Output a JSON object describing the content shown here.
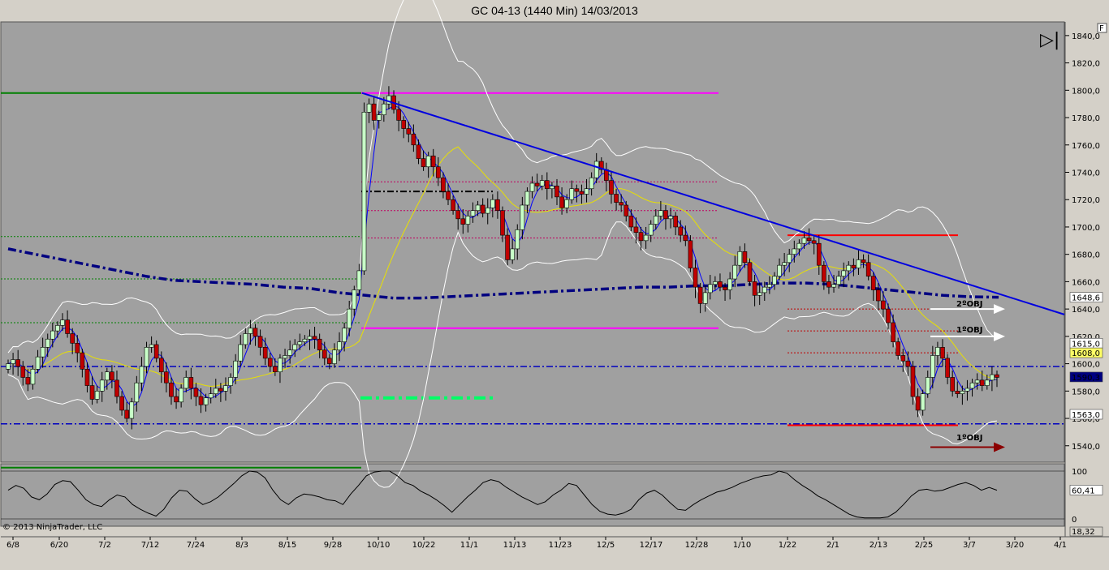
{
  "header": {
    "title": "GC 04-13 (1440 Min)  14/03/2013"
  },
  "copyright": "© 2013 NinjaTrader, LLC",
  "toolbar": {
    "f_button": "F",
    "play_glyph": "▷|"
  },
  "chart_data": {
    "type": "candlestick",
    "instrument": "GC 04-13",
    "period": "1440 Min",
    "date": "14/03/2013",
    "x_tick_labels": [
      "6/8",
      "6/20",
      "7/2",
      "7/12",
      "7/24",
      "8/3",
      "8/15",
      "9/28",
      "10/10",
      "10/22",
      "11/1",
      "11/13",
      "11/23",
      "12/5",
      "12/17",
      "12/28",
      "1/10",
      "1/22",
      "2/1",
      "2/13",
      "2/25",
      "3/7",
      "3/20",
      "4/1"
    ],
    "y_ticks": [
      "1840,0",
      "1820,0",
      "1800,0",
      "1780,0",
      "1760,0",
      "1740,0",
      "1720,0",
      "1700,0",
      "1680,0",
      "1660,0",
      "1640,0",
      "1620,0",
      "1600,0",
      "1580,0",
      "1560,0",
      "1540,0"
    ],
    "ylim": [
      1528,
      1850
    ],
    "close_series": [
      1600,
      1603,
      1598,
      1590,
      1585,
      1596,
      1605,
      1612,
      1618,
      1624,
      1628,
      1632,
      1622,
      1615,
      1608,
      1596,
      1584,
      1574,
      1580,
      1588,
      1594,
      1588,
      1576,
      1566,
      1560,
      1572,
      1586,
      1598,
      1612,
      1614,
      1604,
      1594,
      1586,
      1576,
      1572,
      1582,
      1590,
      1582,
      1576,
      1570,
      1575,
      1578,
      1582,
      1580,
      1584,
      1590,
      1602,
      1614,
      1622,
      1626,
      1620,
      1612,
      1604,
      1598,
      1594,
      1604,
      1606,
      1610,
      1614,
      1616,
      1618,
      1620,
      1618,
      1610,
      1604,
      1600,
      1610,
      1616,
      1626,
      1640,
      1654,
      1668,
      1784,
      1790,
      1778,
      1782,
      1790,
      1796,
      1786,
      1778,
      1772,
      1768,
      1760,
      1750,
      1744,
      1752,
      1744,
      1736,
      1726,
      1720,
      1712,
      1706,
      1702,
      1708,
      1712,
      1716,
      1710,
      1714,
      1720,
      1712,
      1694,
      1676,
      1684,
      1698,
      1716,
      1726,
      1732,
      1730,
      1734,
      1728,
      1730,
      1722,
      1714,
      1720,
      1728,
      1726,
      1724,
      1728,
      1736,
      1748,
      1742,
      1734,
      1724,
      1718,
      1716,
      1708,
      1700,
      1696,
      1690,
      1694,
      1702,
      1708,
      1712,
      1706,
      1708,
      1700,
      1694,
      1690,
      1670,
      1656,
      1644,
      1652,
      1658,
      1660,
      1656,
      1654,
      1662,
      1672,
      1682,
      1674,
      1660,
      1650,
      1652,
      1656,
      1658,
      1664,
      1672,
      1674,
      1680,
      1684,
      1688,
      1692,
      1690,
      1688,
      1672,
      1660,
      1656,
      1658,
      1664,
      1668,
      1672,
      1670,
      1676,
      1674,
      1664,
      1654,
      1646,
      1640,
      1630,
      1616,
      1606,
      1602,
      1598,
      1576,
      1566,
      1578,
      1590,
      1606,
      1612,
      1604,
      1590,
      1580,
      1578,
      1580,
      1582,
      1586,
      1588,
      1584,
      1588,
      1592,
      1590
    ],
    "moving_average_long": [
      1684,
      1680,
      1676,
      1672,
      1668,
      1664,
      1661,
      1660,
      1659,
      1658,
      1656,
      1655,
      1652,
      1650,
      1648,
      1648,
      1649,
      1650,
      1651,
      1652,
      1653,
      1654,
      1655,
      1656,
      1656,
      1657,
      1657,
      1658,
      1659,
      1659,
      1658,
      1656,
      1654,
      1652,
      1650,
      1649,
      1648.6
    ],
    "horizontal_levels": [
      {
        "price": 1798,
        "color": "#008000",
        "style": "solid"
      },
      {
        "price": 1524,
        "color": "#008000",
        "style": "solid"
      },
      {
        "price": 1798,
        "color": "#ff00ff",
        "style": "solid"
      },
      {
        "price": 1626,
        "color": "#ff00ff",
        "style": "solid"
      },
      {
        "price": 1694,
        "color": "#ff0000",
        "style": "solid"
      },
      {
        "price": 1555,
        "color": "#ff0000",
        "style": "solid"
      },
      {
        "price": 1598,
        "color": "#0000c0",
        "style": "dash-dot"
      },
      {
        "price": 1556,
        "color": "#0000c0",
        "style": "dash-dot"
      },
      {
        "price": 1726,
        "color": "#000000",
        "style": "dash-dot"
      }
    ],
    "trendline": {
      "from": {
        "label": "9/28",
        "price": 1798
      },
      "to": {
        "label": "4/1",
        "price": 1636
      },
      "color": "#0000e0"
    },
    "price_tags": [
      {
        "label": "1648,6",
        "bg": "#ffffff",
        "fg": "#000000",
        "price": 1648.6
      },
      {
        "label": "1615,0",
        "bg": "#ffffff",
        "fg": "#000000",
        "price": 1615
      },
      {
        "label": "1608,0",
        "bg": "#ffff66",
        "fg": "#000000",
        "price": 1608
      },
      {
        "label": "1590,3",
        "bg": "#000080",
        "fg": "#ffffff",
        "price": 1590.3
      },
      {
        "label": "1563,0",
        "bg": "#ffffff",
        "fg": "#000000",
        "price": 1563
      }
    ],
    "annotations": [
      {
        "text": "2ºOBJ",
        "color": "#ffffff"
      },
      {
        "text": "1ºOBJ",
        "color": "#ffffff"
      },
      {
        "text": "1ºOBJ",
        "color": "#8b0000"
      }
    ],
    "oscillator": {
      "y_ticks": [
        "100",
        "0"
      ],
      "last_value": "60,41",
      "secondary_value": "18,32",
      "series": [
        60,
        70,
        64,
        46,
        40,
        52,
        72,
        80,
        78,
        60,
        40,
        30,
        26,
        40,
        50,
        46,
        30,
        20,
        12,
        6,
        20,
        44,
        60,
        58,
        42,
        30,
        36,
        46,
        60,
        74,
        90,
        100,
        98,
        86,
        60,
        40,
        30,
        44,
        52,
        50,
        46,
        40,
        38,
        30,
        52,
        70,
        90,
        98,
        100,
        100,
        90,
        76,
        70,
        58,
        50,
        40,
        28,
        14,
        30,
        46,
        60,
        76,
        82,
        78,
        66,
        56,
        46,
        38,
        30,
        36,
        50,
        60,
        74,
        70,
        50,
        30,
        16,
        10,
        8,
        12,
        20,
        40,
        54,
        60,
        50,
        34,
        20,
        18,
        30,
        40,
        48,
        56,
        60,
        66,
        74,
        80,
        86,
        90,
        92,
        100,
        96,
        82,
        70,
        60,
        48,
        40,
        30,
        20,
        10,
        4,
        2,
        2,
        2,
        4,
        14,
        30,
        48,
        60,
        62,
        58,
        60,
        66,
        72,
        76,
        70,
        60,
        66,
        60
      ]
    }
  }
}
